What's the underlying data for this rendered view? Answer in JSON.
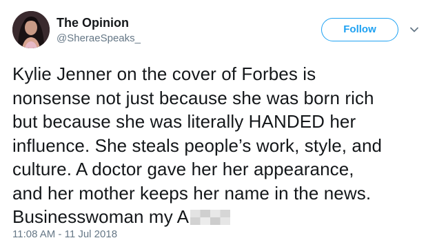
{
  "account": {
    "display_name": "The Opinion",
    "handle": "@SheraeSpeaks_"
  },
  "actions": {
    "follow_label": "Follow",
    "menu_icon": "chevron-down-icon"
  },
  "tweet": {
    "text": "Kylie Jenner on the cover of Forbes is\nnonsense not just because she was born rich\nbut because she was literally HANDED her\ninfluence. She steals people’s work, style, and\nculture. A doctor gave her her appearance,\nand her mother keeps her name in the news.\nBusinesswoman my A",
    "timestamp": "11:08 AM - 11 Jul 2018"
  },
  "colors": {
    "accent": "#1da1f2",
    "text_primary": "#14171a",
    "text_secondary": "#657786"
  }
}
